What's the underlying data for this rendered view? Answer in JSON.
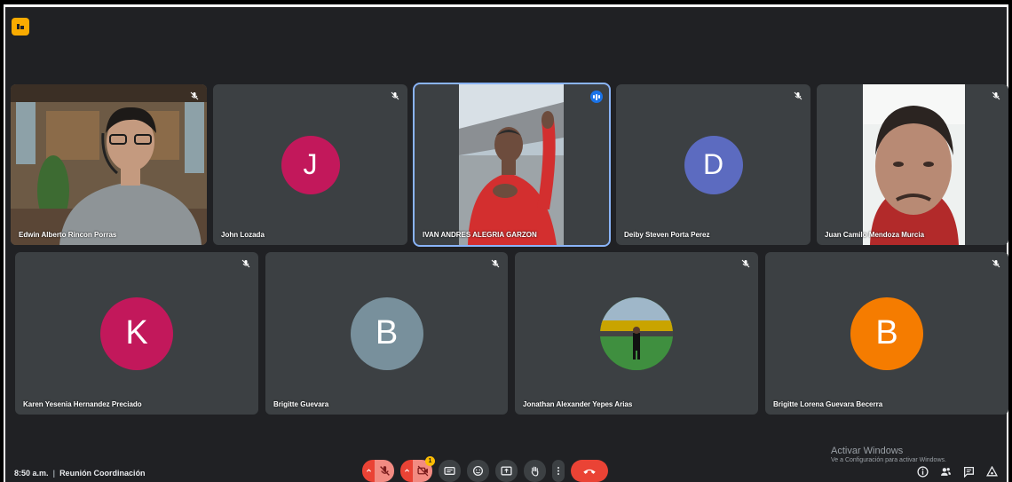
{
  "app": {
    "badge_icon": "app-badge-icon",
    "accent": "#f9ab00"
  },
  "participants_row1": [
    {
      "name": "Edwin Alberto Rincon Porras",
      "type": "video",
      "mic": "muted"
    },
    {
      "name": "John Lozada",
      "type": "avatar",
      "initial": "J",
      "color": "#c2185b",
      "mic": "muted"
    },
    {
      "name": "IVAN ANDRES ALEGRIA GARZON",
      "type": "video",
      "mic": "speaking",
      "active": true
    },
    {
      "name": "Deiby Steven Porta Perez",
      "type": "avatar",
      "initial": "D",
      "color": "#5c6bc0",
      "mic": "muted"
    },
    {
      "name": "Juan Camilo Mendoza Murcia",
      "type": "video",
      "mic": "muted"
    }
  ],
  "participants_row2": [
    {
      "name": "Karen Yesenia Hernandez Preciado",
      "type": "avatar",
      "initial": "K",
      "color": "#c2185b",
      "mic": "muted"
    },
    {
      "name": "Brigitte Guevara",
      "type": "avatar",
      "initial": "B",
      "color": "#78909c",
      "mic": "muted"
    },
    {
      "name": "Jonathan Alexander Yepes Arias",
      "type": "photo",
      "mic": "muted"
    },
    {
      "name": "Brigitte Lorena Guevara Becerra",
      "type": "avatar",
      "initial": "B",
      "color": "#f57c00",
      "mic": "muted"
    }
  ],
  "footer": {
    "time": "8:50 a.m.",
    "separator": "|",
    "meeting_name": "Reunión Coordinación",
    "notification_count": "1"
  },
  "controls": [
    "chevron-up-icon",
    "mic-off-icon",
    "chevron-up-icon",
    "camera-off-icon",
    "captions-icon",
    "emoji-icon",
    "present-icon",
    "raise-hand-icon",
    "more-options-icon",
    "leave-call-icon"
  ],
  "right_tools": [
    "info-icon",
    "people-icon",
    "chat-icon",
    "activities-icon"
  ],
  "watermark": {
    "line1": "Activar Windows",
    "line2": "Ve a Configuración para activar Windows."
  }
}
